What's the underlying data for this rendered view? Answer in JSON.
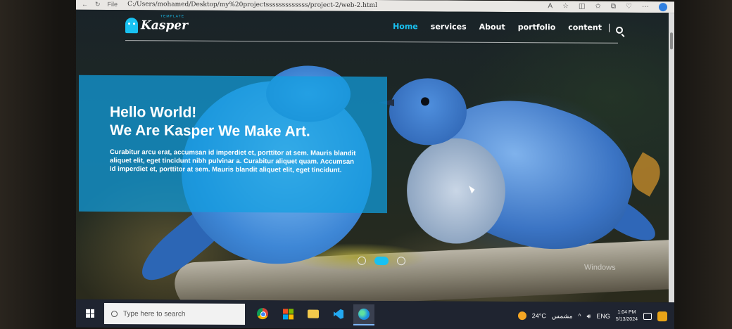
{
  "browser": {
    "url": "C:/Users/mohamed/Desktop/my%20projectsssssssssssss/project-2/web-2.html",
    "file_label": "File"
  },
  "logo": {
    "tag": "TEMPLATE",
    "text": "Kasper"
  },
  "nav": {
    "items": [
      {
        "label": "Home",
        "active": true
      },
      {
        "label": "services",
        "active": false
      },
      {
        "label": "About",
        "active": false
      },
      {
        "label": "portfolio",
        "active": false
      },
      {
        "label": "content",
        "active": false
      }
    ]
  },
  "hero": {
    "title_line1": "Hello World!",
    "title_line2": "We Are Kasper We Make Art.",
    "text": "Curabitur arcu erat, accumsan id imperdiet et, porttitor at sem. Mauris blandit aliquet elit, eget tincidunt nibh pulvinar a. Curabitur aliquet quam. Accumsan id imperdiet et, porttitor at sem. Mauris blandit aliquet elit, eget tincidunt."
  },
  "slider": {
    "count": 3,
    "active_index": 1
  },
  "watermark": "Windows",
  "taskbar": {
    "search_placeholder": "Type here to search",
    "weather_temp": "24°C",
    "weather_text": "مشمس",
    "lang": "ENG",
    "time": "1:04 PM",
    "date": "5/13/2024"
  },
  "colors": {
    "accent": "#19c1f1",
    "hero_overlay": "#10a0e1"
  }
}
